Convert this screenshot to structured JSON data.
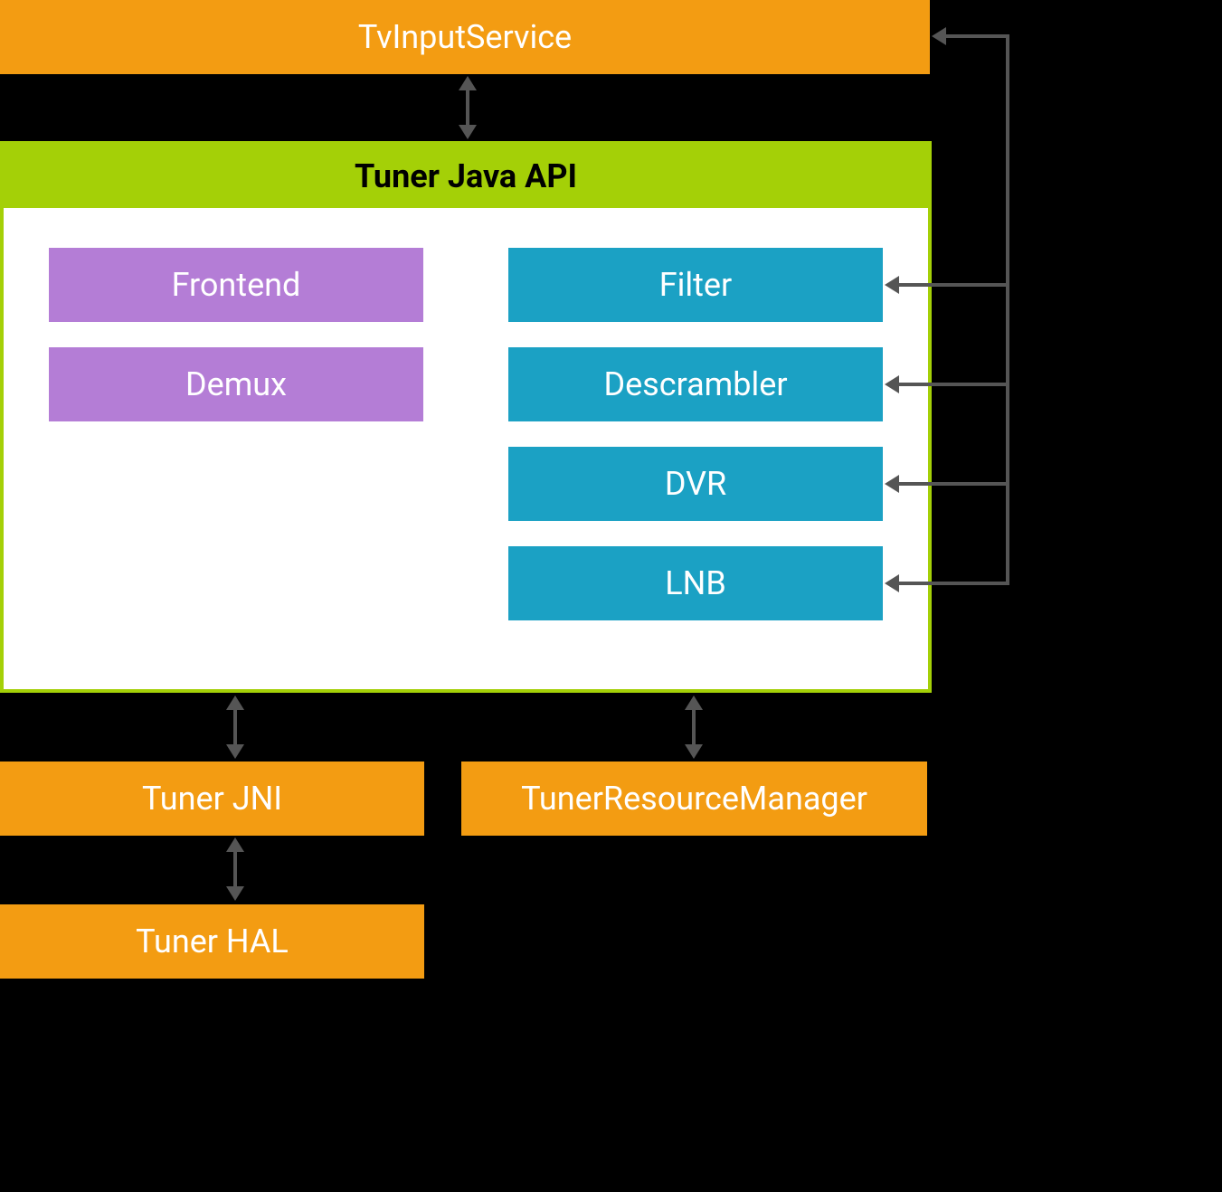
{
  "header": {
    "tv_input_service": "TvInputService"
  },
  "api": {
    "title": "Tuner Java API",
    "left_blocks": {
      "frontend": "Frontend",
      "demux": "Demux"
    },
    "right_blocks": {
      "filter": "Filter",
      "descrambler": "Descrambler",
      "dvr": "DVR",
      "lnb": "LNB"
    }
  },
  "footer": {
    "tuner_jni": "Tuner JNI",
    "tuner_resource_manager": "TunerResourceManager",
    "tuner_hal": "Tuner HAL"
  },
  "colors": {
    "orange": "#f39c12",
    "green": "#a4d007",
    "purple": "#b47dd6",
    "blue": "#1ba1c4",
    "arrow": "#555555"
  }
}
